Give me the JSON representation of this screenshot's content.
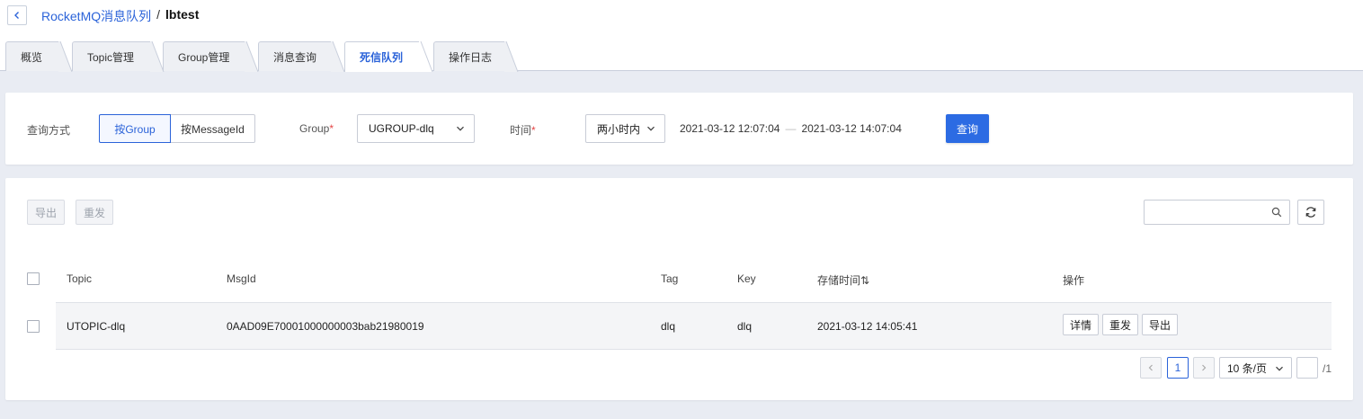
{
  "header": {
    "back_icon": "chevron-left-icon",
    "breadcrumb_link": "RocketMQ消息队列",
    "breadcrumb_sep": "/",
    "breadcrumb_current": "lbtest"
  },
  "tabs": [
    {
      "label": "概览"
    },
    {
      "label": "Topic管理"
    },
    {
      "label": "Group管理"
    },
    {
      "label": "消息查询"
    },
    {
      "label": "死信队列",
      "active": true
    },
    {
      "label": "操作日志"
    }
  ],
  "filter": {
    "query_mode_label": "查询方式",
    "mode_group": "按Group",
    "mode_msgid": "按MessageId",
    "group_label": "Group",
    "group_required": "*",
    "group_value": "UGROUP-dlq",
    "time_label": "时间",
    "time_required": "*",
    "time_value": "两小时内",
    "date_start": "2021-03-12 12:07:04",
    "date_sep": "—",
    "date_end": "2021-03-12 14:07:04",
    "query_button": "查询"
  },
  "toolbar": {
    "export_label": "导出",
    "resend_label": "重发",
    "search_placeholder": ""
  },
  "table": {
    "headers": {
      "topic": "Topic",
      "msgid": "MsgId",
      "tag": "Tag",
      "key": "Key",
      "stored_time": "存储时间",
      "sort_glyph": "⇅",
      "actions": "操作"
    },
    "rows": [
      {
        "topic": "UTOPIC-dlq",
        "msgid": "0AAD09E70001000000003bab21980019",
        "tag": "dlq",
        "key": "dlq",
        "stored_time": "2021-03-12 14:05:41",
        "action_detail": "详情",
        "action_resend": "重发",
        "action_export": "导出"
      }
    ]
  },
  "pagination": {
    "current_page": "1",
    "page_size": "10 条/页",
    "total_pages": "/1"
  },
  "colors": {
    "accent": "#2b63d9",
    "primary_button": "#2c6be3",
    "required": "#e54545"
  }
}
